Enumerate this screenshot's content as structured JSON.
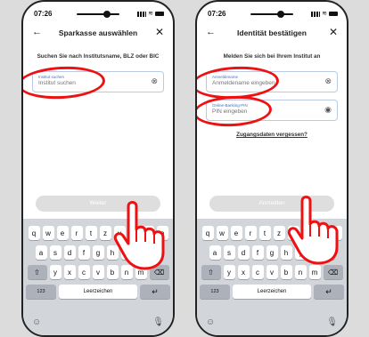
{
  "screens": [
    {
      "status": {
        "time": "07:26"
      },
      "title": "Sparkasse auswählen",
      "prompt": "Suchen Sie nach Institutsname, BLZ oder BIC",
      "fields": [
        {
          "label": "Institut suchen",
          "placeholder": "Institut suchen",
          "icon": "clear-icon",
          "icon_glyph": "⊗"
        }
      ],
      "button": "Weiter",
      "keyboard": {
        "row1": [
          "q",
          "w",
          "e",
          "r",
          "t",
          "z",
          "u",
          "i",
          "o",
          "p"
        ],
        "row2": [
          "a",
          "s",
          "d",
          "f",
          "g",
          "h",
          "j",
          "k",
          "l"
        ],
        "row3": [
          "y",
          "x",
          "c",
          "v",
          "b",
          "n",
          "m"
        ],
        "shift": "⇧",
        "backspace": "⌫",
        "num": "123",
        "space": "Leerzeichen",
        "return": "↵",
        "emoji": "☺",
        "mic": "🎙"
      }
    },
    {
      "status": {
        "time": "07:26"
      },
      "title": "Identität bestätigen",
      "prompt": "Melden Sie sich bei Ihrem Institut an",
      "fields": [
        {
          "label": "Anmeldename",
          "placeholder": "Anmeldename eingeben",
          "icon": "clear-icon",
          "icon_glyph": "⊗"
        },
        {
          "label": "Online-Banking-PIN",
          "placeholder": "PIN eingeben",
          "icon": "eye-icon",
          "icon_glyph": "◉"
        }
      ],
      "forgot_link": "Zugangsdaten vergessen?",
      "button": "Anmelden",
      "keyboard": {
        "row1": [
          "q",
          "w",
          "e",
          "r",
          "t",
          "z",
          "u",
          "i",
          "o",
          "p"
        ],
        "row2": [
          "a",
          "s",
          "d",
          "f",
          "g",
          "h",
          "j",
          "k",
          "l"
        ],
        "row3": [
          "y",
          "x",
          "c",
          "v",
          "b",
          "n",
          "m"
        ],
        "shift": "⇧",
        "backspace": "⌫",
        "num": "123",
        "space": "Leerzeichen",
        "return": "↵",
        "emoji": "☺",
        "mic": "🎙"
      }
    }
  ],
  "common": {
    "back_glyph": "←",
    "close_glyph": "✕",
    "wifi_glyph": "≋"
  },
  "colors": {
    "highlight": "#e11111",
    "field_label": "#3b74c7",
    "button_disabled": "#dedede"
  }
}
